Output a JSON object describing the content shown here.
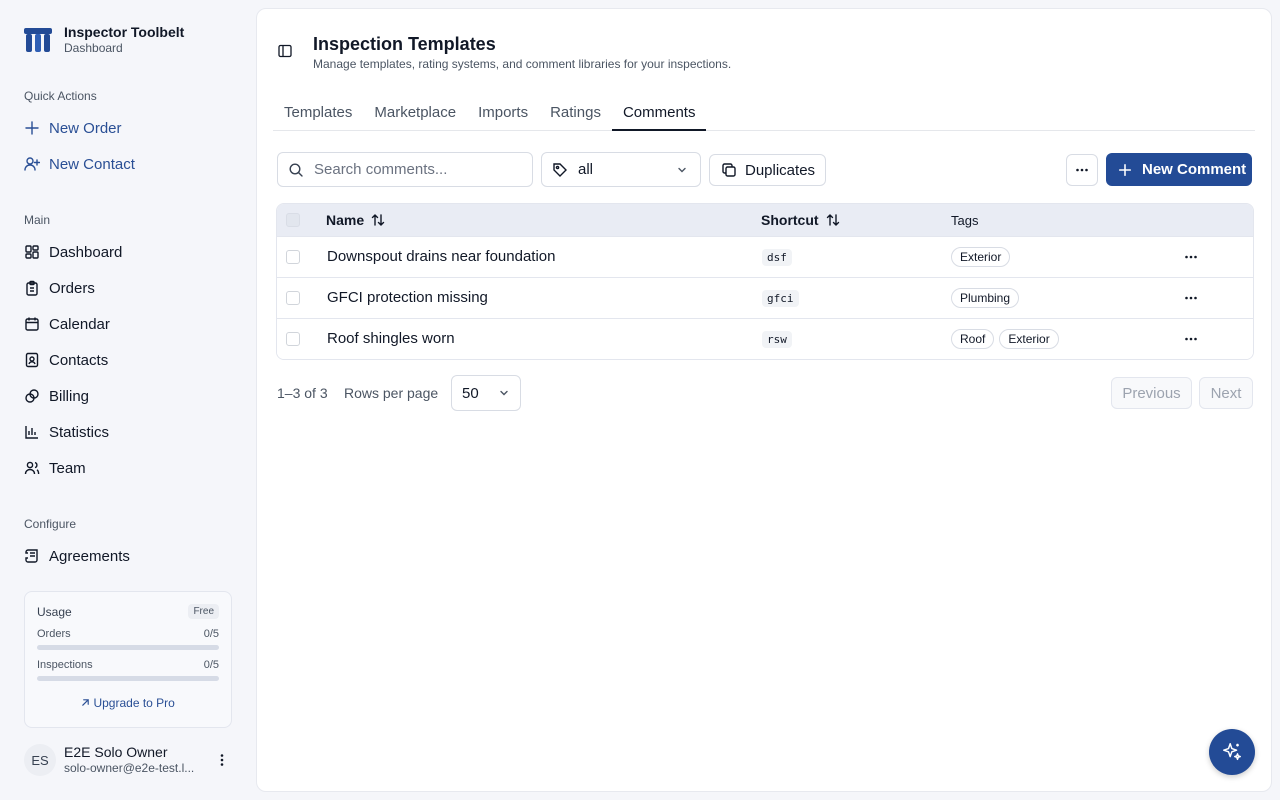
{
  "brand": {
    "title": "Inspector Toolbelt",
    "subtitle": "Dashboard"
  },
  "sidebar": {
    "quick_actions_label": "Quick Actions",
    "quick_actions": [
      {
        "label": "New Order",
        "icon": "plus-icon"
      },
      {
        "label": "New Contact",
        "icon": "user-plus-icon"
      }
    ],
    "main_label": "Main",
    "main_items": [
      {
        "label": "Dashboard",
        "icon": "grid-icon"
      },
      {
        "label": "Orders",
        "icon": "clipboard-icon"
      },
      {
        "label": "Calendar",
        "icon": "calendar-icon"
      },
      {
        "label": "Contacts",
        "icon": "contact-icon"
      },
      {
        "label": "Billing",
        "icon": "billing-icon"
      },
      {
        "label": "Statistics",
        "icon": "bar-chart-icon"
      },
      {
        "label": "Team",
        "icon": "users-icon"
      }
    ],
    "configure_label": "Configure",
    "configure_items": [
      {
        "label": "Agreements",
        "icon": "scroll-icon"
      }
    ]
  },
  "usage": {
    "title": "Usage",
    "plan": "Free",
    "rows": [
      {
        "label": "Orders",
        "value": "0/5",
        "fraction": 0
      },
      {
        "label": "Inspections",
        "value": "0/5",
        "fraction": 0
      }
    ],
    "upgrade_label": "Upgrade to Pro"
  },
  "user": {
    "initials": "ES",
    "name": "E2E Solo Owner",
    "email": "solo-owner@e2e-test.l..."
  },
  "page": {
    "title": "Inspection Templates",
    "subtitle": "Manage templates, rating systems, and comment libraries for your inspections."
  },
  "tabs": [
    {
      "label": "Templates",
      "active": false
    },
    {
      "label": "Marketplace",
      "active": false
    },
    {
      "label": "Imports",
      "active": false
    },
    {
      "label": "Ratings",
      "active": false
    },
    {
      "label": "Comments",
      "active": true
    }
  ],
  "toolbar": {
    "search_placeholder": "Search comments...",
    "tag_filter_value": "all",
    "duplicates_label": "Duplicates",
    "new_comment_label": "New Comment"
  },
  "table": {
    "columns": {
      "name": "Name",
      "shortcut": "Shortcut",
      "tags": "Tags"
    },
    "rows": [
      {
        "name": "Downspout drains near foundation",
        "shortcut": "dsf",
        "tags": [
          "Exterior"
        ]
      },
      {
        "name": "GFCI protection missing",
        "shortcut": "gfci",
        "tags": [
          "Plumbing"
        ]
      },
      {
        "name": "Roof shingles worn",
        "shortcut": "rsw",
        "tags": [
          "Roof",
          "Exterior"
        ]
      }
    ]
  },
  "pagination": {
    "range": "1–3 of 3",
    "rows_per_page_label": "Rows per page",
    "rows_per_page_value": "50",
    "previous_label": "Previous",
    "next_label": "Next"
  },
  "colors": {
    "accent": "#234b96",
    "link": "#2a4f95"
  }
}
